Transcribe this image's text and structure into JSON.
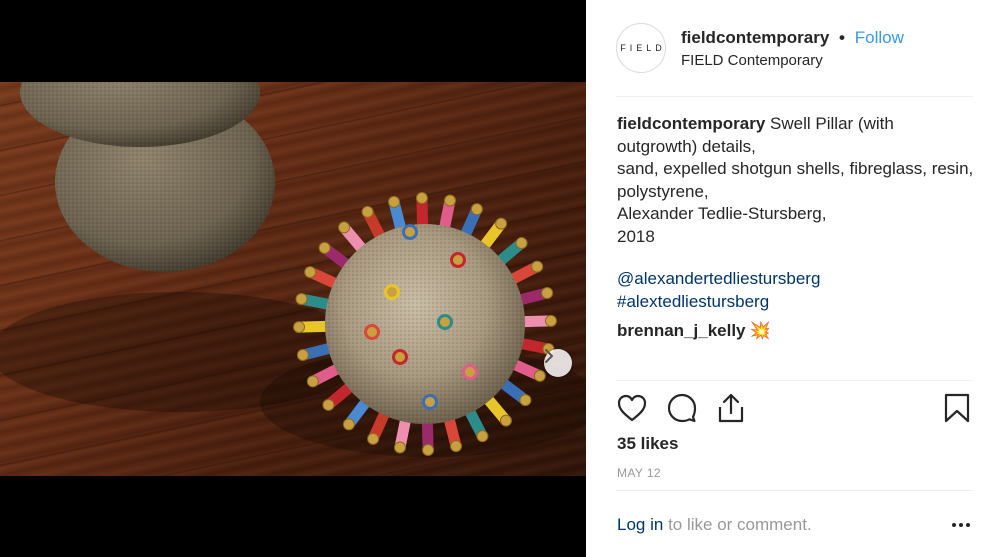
{
  "post": {
    "dots_count": 2,
    "active_dot": 0
  },
  "header": {
    "avatar_text": "FIELD",
    "username": "fieldcontemporary",
    "separator": "•",
    "follow_label": "Follow",
    "full_name": "FIELD Contemporary"
  },
  "caption": {
    "username": "fieldcontemporary",
    "lines": [
      "Swell Pillar (with outgrowth) details,",
      "sand, expelled shotgun shells, fibreglass, resin, polystyrene,",
      "Alexander Tedlie-Stursberg,",
      "2018"
    ],
    "mention": "@alexandertedliestursberg",
    "hashtag": "#alextedliestursberg"
  },
  "comment": {
    "username": "brennan_j_kelly",
    "text": "💥"
  },
  "actions": {
    "like_icon": "heart-icon",
    "comment_icon": "comment-icon",
    "share_icon": "share-icon",
    "save_icon": "bookmark-icon"
  },
  "likes_label": "35 likes",
  "date_label": "MAY 12",
  "footer": {
    "login_label": "Log in",
    "prompt": "to like or comment."
  },
  "colors": {
    "link_blue": "#3897f0",
    "dark_link": "#003569",
    "text": "#262626",
    "muted": "#999999"
  }
}
